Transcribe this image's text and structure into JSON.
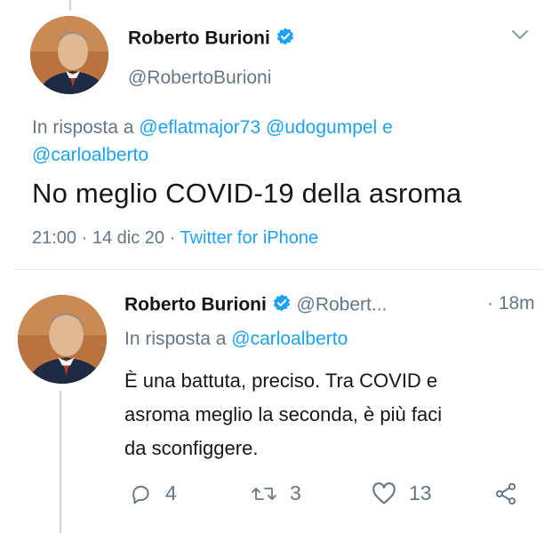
{
  "tweet": {
    "author_name": "Roberto Burioni",
    "handle": "@RobertoBurioni",
    "reply_prefix": "In risposta a",
    "reply_to_1": "@eflatmajor73",
    "reply_to_2": "@udogumpel",
    "reply_conj": "e",
    "reply_to_3": "@carloalberto",
    "text": "No meglio COVID-19 della asroma",
    "time": "21:00",
    "date": "14 dic 20",
    "source": "Twitter for iPhone",
    "sep": "·"
  },
  "reply": {
    "author_name": "Roberto Burioni",
    "handle": "@Robert...",
    "time_ago": "· 18m",
    "reply_prefix": "In risposta a",
    "reply_to": "@carloalberto",
    "text_line1": "È una battuta, preciso. Tra COVID e",
    "text_line2": "asroma meglio la seconda, è più faci",
    "text_line3": "da sconfiggere.",
    "actions": {
      "replies": "4",
      "retweets": "3",
      "likes": "13"
    }
  },
  "icons": {
    "verified": "verified-badge-icon",
    "chevron": "chevron-down-icon",
    "reply": "reply-icon",
    "retweet": "retweet-icon",
    "like": "heart-icon",
    "share": "share-icon"
  },
  "colors": {
    "accent": "#1da1f2",
    "muted": "#657786",
    "text": "#14171a"
  }
}
